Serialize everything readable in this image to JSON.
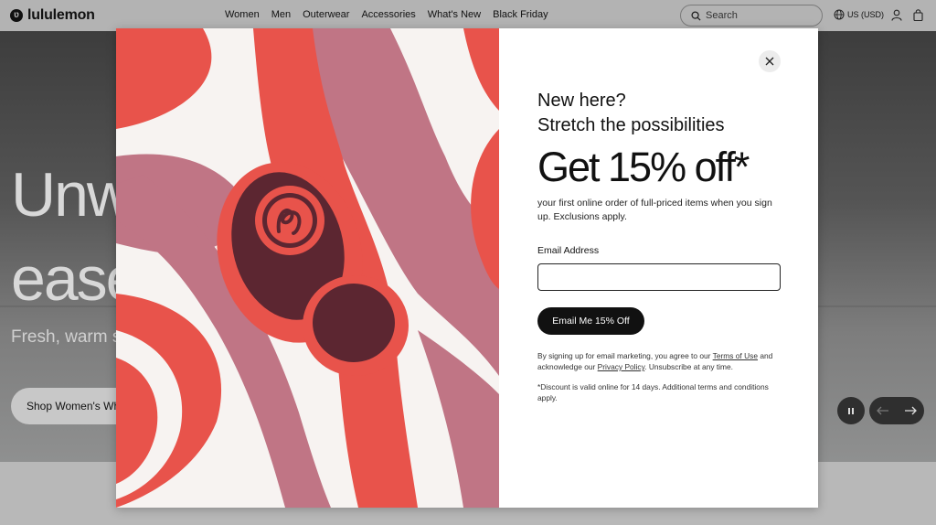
{
  "header": {
    "logo_text": "lululemon",
    "nav": [
      "Women",
      "Men",
      "Outerwear",
      "Accessories",
      "What's New",
      "Black Friday"
    ],
    "search_placeholder": "Search",
    "region": "US (USD)"
  },
  "hero": {
    "title_line1": "Unw",
    "title_line2": "ease",
    "subtitle": "Fresh, warm s",
    "cta": "Shop Women's Wh"
  },
  "modal": {
    "heading_line1": "New here?",
    "heading_line2": "Stretch the possibilities",
    "offer": "Get 15% off*",
    "description": "your first online order of full-priced items when you sign up. Exclusions apply.",
    "email_label": "Email Address",
    "email_value": "",
    "submit_label": "Email Me 15% Off",
    "legal_prefix": "By signing up for email marketing, you agree to our ",
    "terms_link": "Terms of Use",
    "legal_middle": " and acknowledge our ",
    "privacy_link": "Privacy Policy",
    "legal_suffix": ". Unsubscribe at any time.",
    "disclaimer": "*Discount is valid online for 14 days. Additional terms and conditions apply."
  },
  "colors": {
    "coral": "#e8534b",
    "mauve": "#c07585",
    "maroon": "#5c2631",
    "cream": "#f7f3f1"
  },
  "icons": [
    "search-icon",
    "globe-icon",
    "user-icon",
    "bag-icon",
    "close-icon",
    "pause-icon",
    "arrow-left-icon",
    "arrow-right-icon"
  ]
}
